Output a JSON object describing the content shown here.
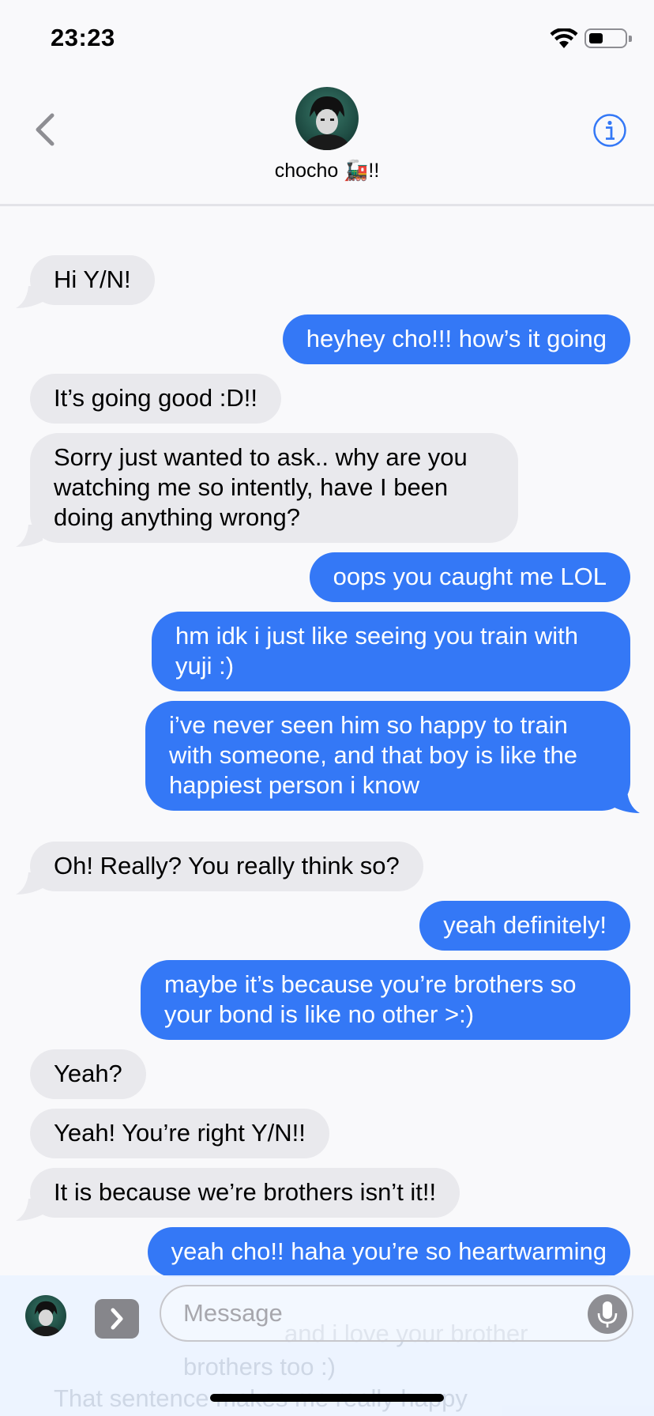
{
  "status": {
    "time": "23:23"
  },
  "header": {
    "contact_name": "chocho 🚂!!"
  },
  "messages": [
    {
      "from": "them",
      "text": "Hi Y/N!"
    },
    {
      "from": "me",
      "text": "heyhey cho!!! how’s it going"
    },
    {
      "from": "them",
      "text": "It’s going good :D!!"
    },
    {
      "from": "them",
      "text": "Sorry just wanted to ask.. why are you watching me so intently, have I been doing anything wrong?"
    },
    {
      "from": "me",
      "text": "oops you caught me LOL"
    },
    {
      "from": "me",
      "text": "hm idk i just like seeing you train with yuji :)"
    },
    {
      "from": "me",
      "text": "i’ve never seen him so happy to train with someone, and that boy is like the happiest person i know"
    },
    {
      "from": "them",
      "text": "Oh! Really? You really think so?"
    },
    {
      "from": "me",
      "text": "yeah definitely!"
    },
    {
      "from": "me",
      "text": "maybe it’s because you’re brothers so your bond is like no other >:)"
    },
    {
      "from": "them",
      "text": "Yeah?"
    },
    {
      "from": "them",
      "text": "Yeah! You’re right Y/N!!"
    },
    {
      "from": "them",
      "text": "It is because we’re brothers isn’t it!!"
    },
    {
      "from": "me",
      "text": "yeah cho!! haha you’re so heartwarming"
    }
  ],
  "input": {
    "placeholder": "Message"
  },
  "behind_bar": {
    "line1": "and i love your brother",
    "line2": "brothers too :)",
    "line3": "That sentence makes me really happy"
  },
  "colors": {
    "outgoing": "#3478f6",
    "incoming": "#e9e9ed",
    "accent": "#3478f6"
  },
  "icons": [
    "back-chevron-icon",
    "info-icon",
    "wifi-icon",
    "battery-icon",
    "apps-icon",
    "microphone-icon"
  ]
}
